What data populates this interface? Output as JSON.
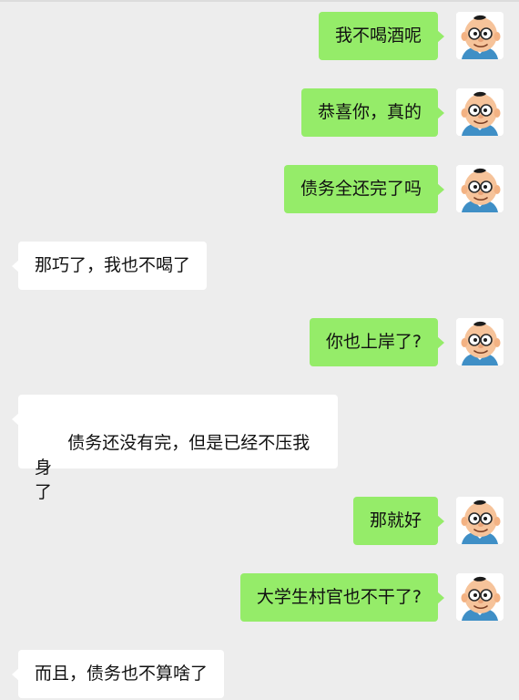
{
  "chat": {
    "messages": [
      {
        "side": "sent",
        "text": "我不喝酒呢"
      },
      {
        "side": "sent",
        "text": "恭喜你，真的"
      },
      {
        "side": "sent",
        "text": "债务全还完了吗"
      },
      {
        "side": "received",
        "text": "那巧了，我也不喝了"
      },
      {
        "side": "sent",
        "text": "你也上岸了?"
      },
      {
        "side": "received",
        "text": "债务还没有完，但是已经不压我身\n了"
      },
      {
        "side": "sent",
        "text": "那就好"
      },
      {
        "side": "sent",
        "text": "大学生村官也不干了?"
      },
      {
        "side": "received",
        "text": "而且，债务也不算啥了"
      }
    ],
    "avatar_icon": "cartoon-boy-avatar-icon",
    "colors": {
      "background": "#ededed",
      "sent_bubble": "#95ec69",
      "received_bubble": "#ffffff",
      "text": "#111111"
    }
  }
}
